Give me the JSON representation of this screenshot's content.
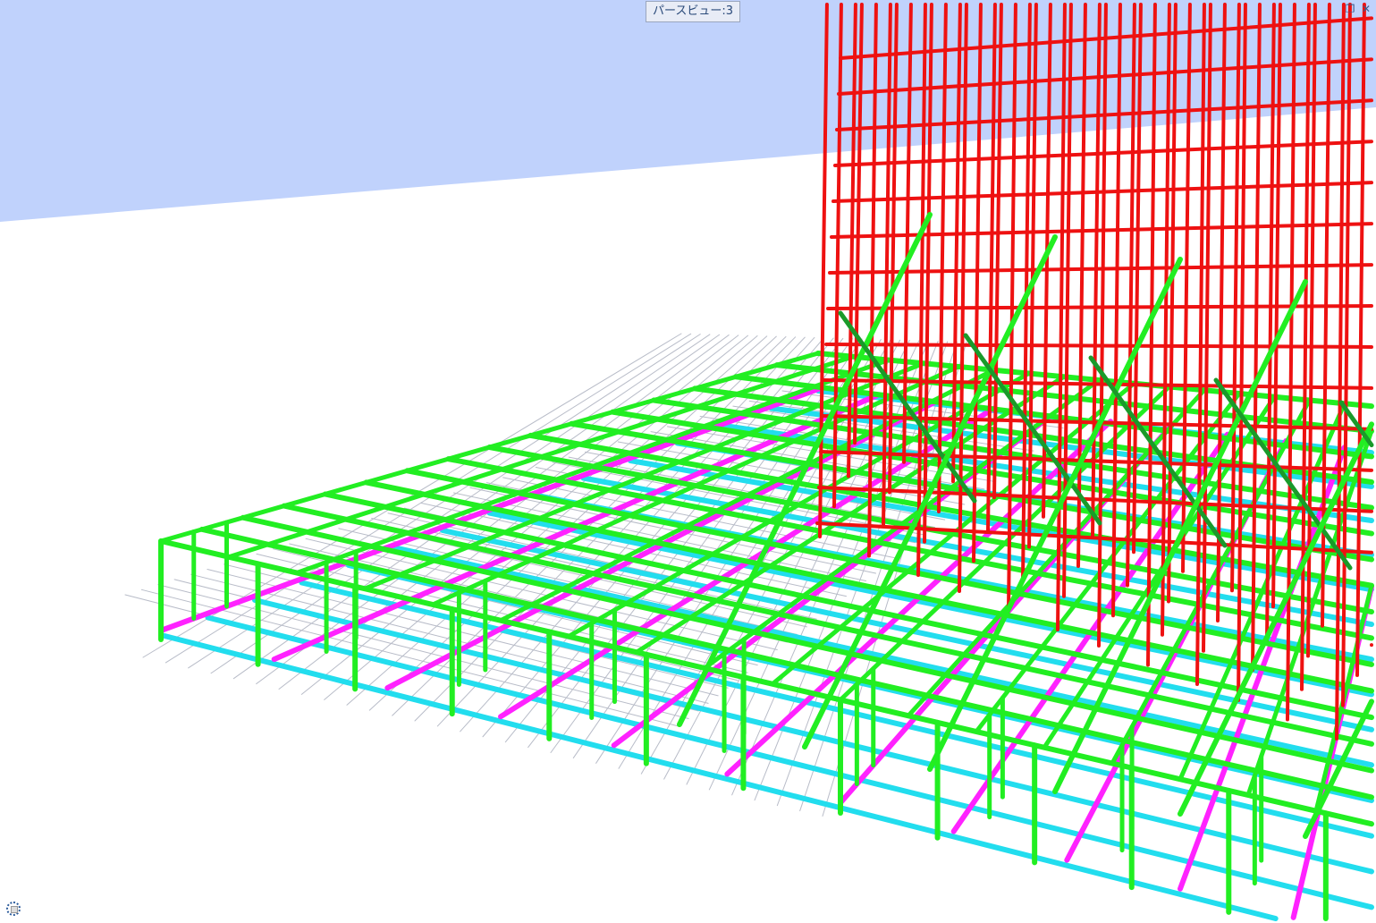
{
  "view": {
    "title": "パースビュー:3"
  },
  "window_controls": {
    "restore_icon": "restore-window-icon",
    "close_icon": "close-icon"
  },
  "navigation": {
    "icon": "steering-wheel-icon"
  },
  "colors": {
    "sky": "#c0d2fc",
    "ground": "#ffffff",
    "top_rebar": "#22ee22",
    "bottom_rebar_x": "#ff22ff",
    "bottom_rebar_y": "#22ddee",
    "column_rebar": "#ee1111",
    "shadow": "#b8bcc8"
  }
}
